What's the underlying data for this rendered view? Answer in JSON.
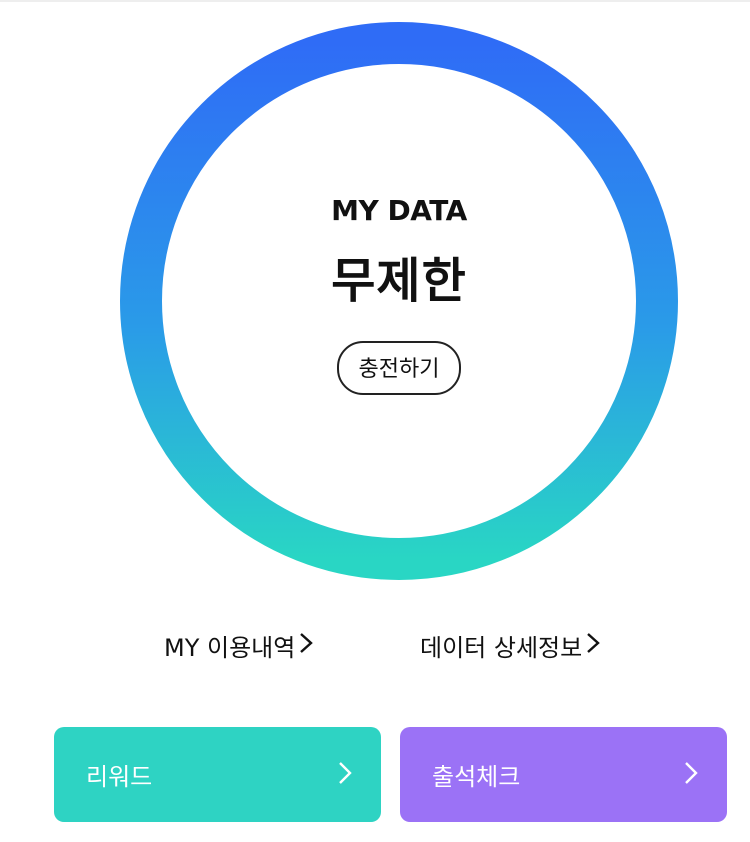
{
  "ring": {
    "title": "MY DATA",
    "value": "무제한",
    "charge_label": "충전하기",
    "colors": {
      "top": "#2f6df5",
      "bottom": "#2ad3c5"
    }
  },
  "links": {
    "usage": "MY 이용내역",
    "details": "데이터 상세정보"
  },
  "cards": {
    "reward": {
      "label": "리워드",
      "color": "#2ed3c3"
    },
    "attendance": {
      "label": "출석체크",
      "color": "#9b72f6"
    }
  }
}
